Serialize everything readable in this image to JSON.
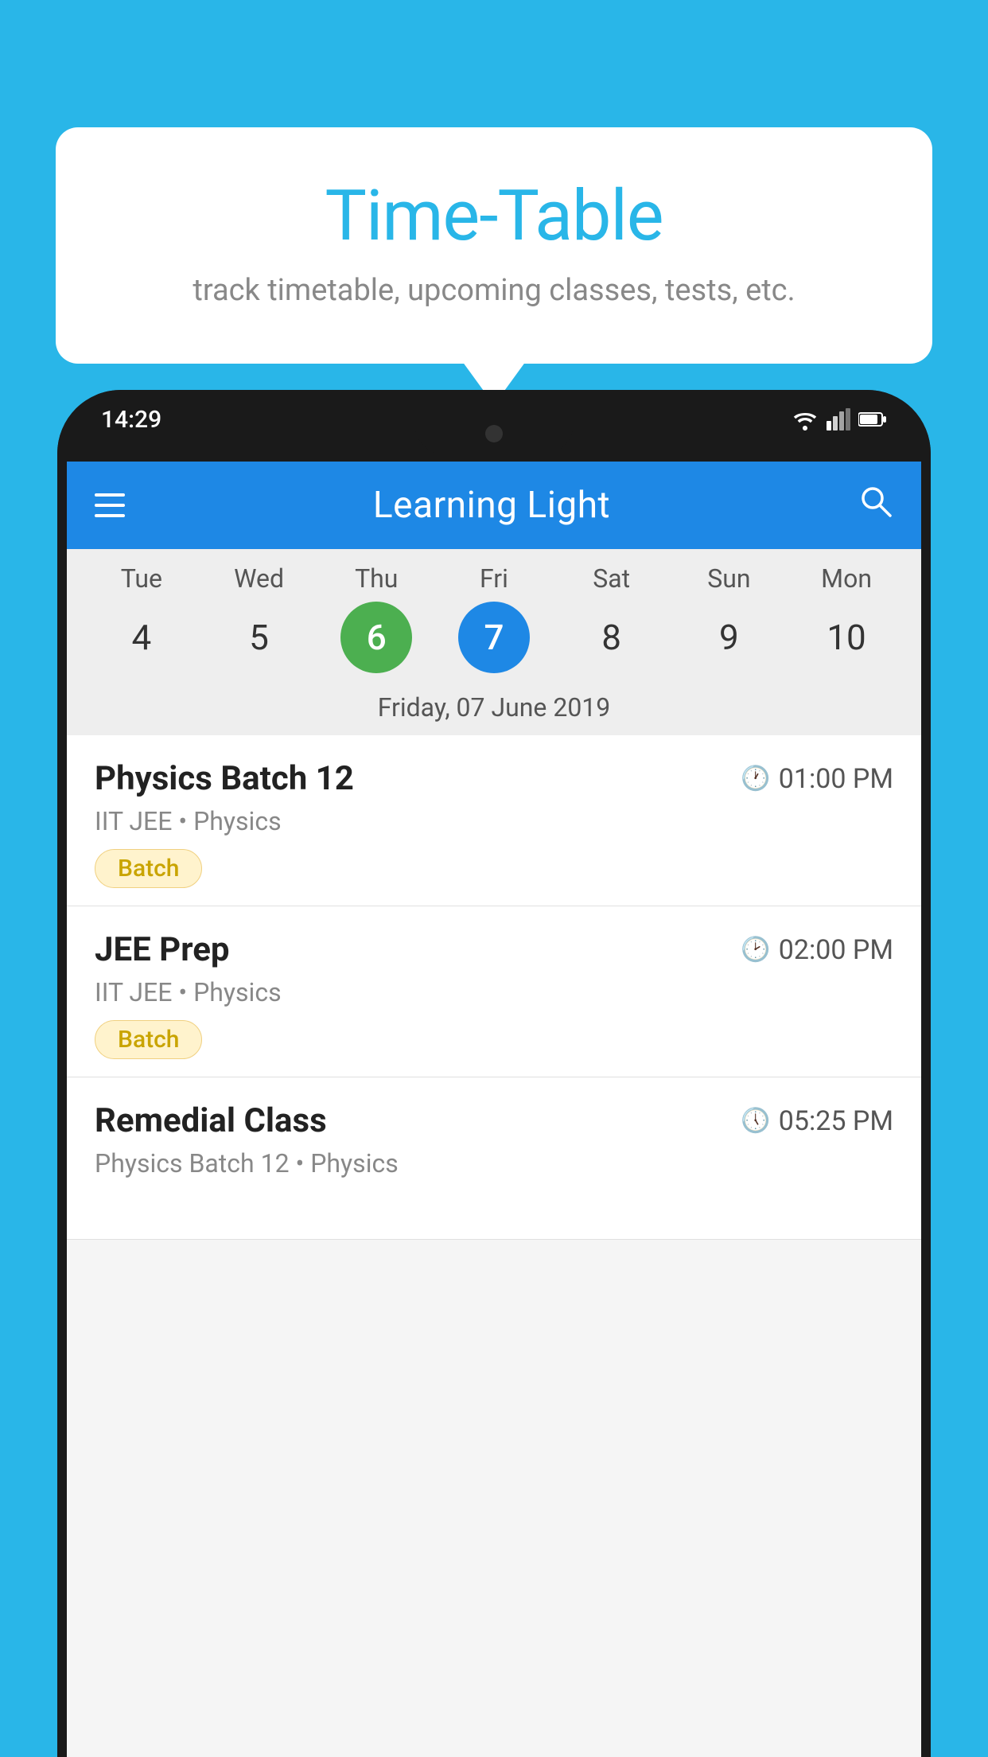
{
  "background_color": "#29b6e8",
  "speech_bubble": {
    "title": "Time-Table",
    "subtitle": "track timetable, upcoming classes, tests, etc."
  },
  "status_bar": {
    "time": "14:29",
    "icons": [
      "wifi",
      "signal",
      "battery"
    ]
  },
  "app_bar": {
    "title": "Learning Light",
    "menu_icon": "hamburger",
    "search_icon": "search"
  },
  "calendar": {
    "days": [
      {
        "label": "Tue",
        "num": "4"
      },
      {
        "label": "Wed",
        "num": "5"
      },
      {
        "label": "Thu",
        "num": "6",
        "state": "today"
      },
      {
        "label": "Fri",
        "num": "7",
        "state": "selected"
      },
      {
        "label": "Sat",
        "num": "8"
      },
      {
        "label": "Sun",
        "num": "9"
      },
      {
        "label": "Mon",
        "num": "10"
      }
    ],
    "selected_date_label": "Friday, 07 June 2019"
  },
  "classes": [
    {
      "title": "Physics Batch 12",
      "time": "01:00 PM",
      "meta": "IIT JEE • Physics",
      "badge": "Batch"
    },
    {
      "title": "JEE Prep",
      "time": "02:00 PM",
      "meta": "IIT JEE • Physics",
      "badge": "Batch"
    },
    {
      "title": "Remedial Class",
      "time": "05:25 PM",
      "meta": "Physics Batch 12 • Physics",
      "badge": ""
    }
  ]
}
